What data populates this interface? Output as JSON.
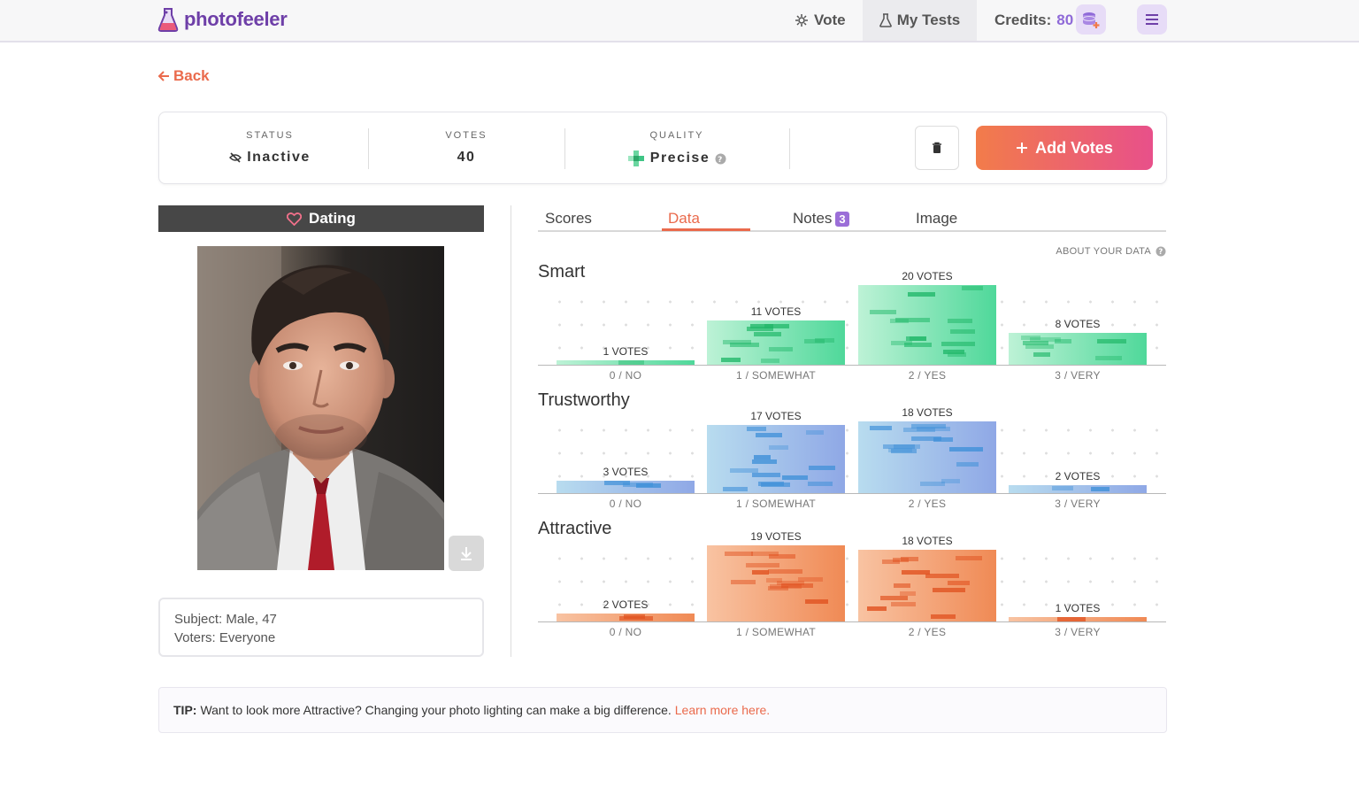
{
  "nav": {
    "logo": "photofeeler",
    "vote": "Vote",
    "my_tests": "My Tests",
    "credits_label": "Credits:",
    "credits_value": "80"
  },
  "back": "Back",
  "status": {
    "status_label": "STATUS",
    "status_value": "Inactive",
    "votes_label": "VOTES",
    "votes_value": "40",
    "quality_label": "QUALITY",
    "quality_value": "Precise",
    "add_votes": "Add Votes"
  },
  "category": "Dating",
  "info": {
    "subject": "Subject: Male, 47",
    "voters": "Voters: Everyone"
  },
  "tabs": [
    {
      "label": "Scores"
    },
    {
      "label": "Data"
    },
    {
      "label": "Notes",
      "badge": "3"
    },
    {
      "label": "Image"
    }
  ],
  "about_data": "ABOUT YOUR DATA",
  "chart_data": [
    {
      "type": "bar",
      "title": "Smart",
      "categories": [
        "0 / NO",
        "1 / SOMEWHAT",
        "2 / YES",
        "3 / VERY"
      ],
      "values": [
        1,
        11,
        20,
        8
      ],
      "labels": [
        "1 VOTES",
        "11 VOTES",
        "20 VOTES",
        "8 VOTES"
      ],
      "color_light": "#bdf2d6",
      "color_dark": "#4fd89a",
      "stripe": "#22b86a"
    },
    {
      "type": "bar",
      "title": "Trustworthy",
      "categories": [
        "0 / NO",
        "1 / SOMEWHAT",
        "2 / YES",
        "3 / VERY"
      ],
      "values": [
        3,
        17,
        18,
        2
      ],
      "labels": [
        "3 VOTES",
        "17 VOTES",
        "18 VOTES",
        "2 VOTES"
      ],
      "color_light": "#b8dcef",
      "color_dark": "#8fa8e6",
      "stripe": "#3d8fd8"
    },
    {
      "type": "bar",
      "title": "Attractive",
      "categories": [
        "0 / NO",
        "1 / SOMEWHAT",
        "2 / YES",
        "3 / VERY"
      ],
      "values": [
        2,
        19,
        18,
        1
      ],
      "labels": [
        "2 VOTES",
        "19 VOTES",
        "18 VOTES",
        "1 VOTES"
      ],
      "color_light": "#f8c3a2",
      "color_dark": "#f08a55",
      "stripe": "#e0501e"
    }
  ],
  "tip": {
    "prefix": "TIP:",
    "text": "Want to look more Attractive? Changing your photo lighting can make a big difference.",
    "link": "Learn more here."
  }
}
